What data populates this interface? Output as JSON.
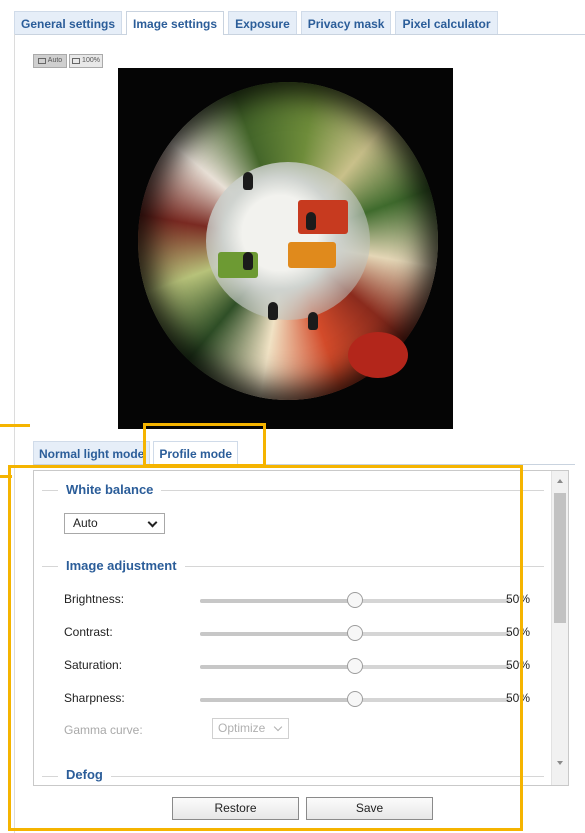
{
  "top_tabs": [
    {
      "label": "General settings",
      "active": false
    },
    {
      "label": "Image settings",
      "active": true
    },
    {
      "label": "Exposure",
      "active": false
    },
    {
      "label": "Privacy mask",
      "active": false
    },
    {
      "label": "Pixel calculator",
      "active": false
    }
  ],
  "view_toggle": {
    "auto_label": "Auto",
    "full_label": "100%"
  },
  "mode_tabs": [
    {
      "label": "Normal light mode",
      "active": false
    },
    {
      "label": "Profile mode",
      "active": true
    }
  ],
  "white_balance": {
    "legend": "White balance",
    "value": "Auto"
  },
  "image_adjustment": {
    "legend": "Image adjustment",
    "rows": [
      {
        "label": "Brightness:",
        "value": "50%",
        "level": 0.5
      },
      {
        "label": "Contrast:",
        "value": "50%",
        "level": 0.5
      },
      {
        "label": "Saturation:",
        "value": "50%",
        "level": 0.5
      },
      {
        "label": "Sharpness:",
        "value": "50%",
        "level": 0.5
      }
    ],
    "gamma": {
      "label": "Gamma curve:",
      "value": "Optimize"
    }
  },
  "defog": {
    "legend": "Defog"
  },
  "buttons": {
    "restore": "Restore",
    "save": "Save"
  },
  "colors": {
    "accent": "#2b5d99",
    "tab_bg": "#e6eef8",
    "highlight": "#f5b400"
  },
  "icons": {
    "dropdown": "chevron-down-icon",
    "view_auto": "monitor-icon",
    "view_full": "monitor-icon"
  }
}
